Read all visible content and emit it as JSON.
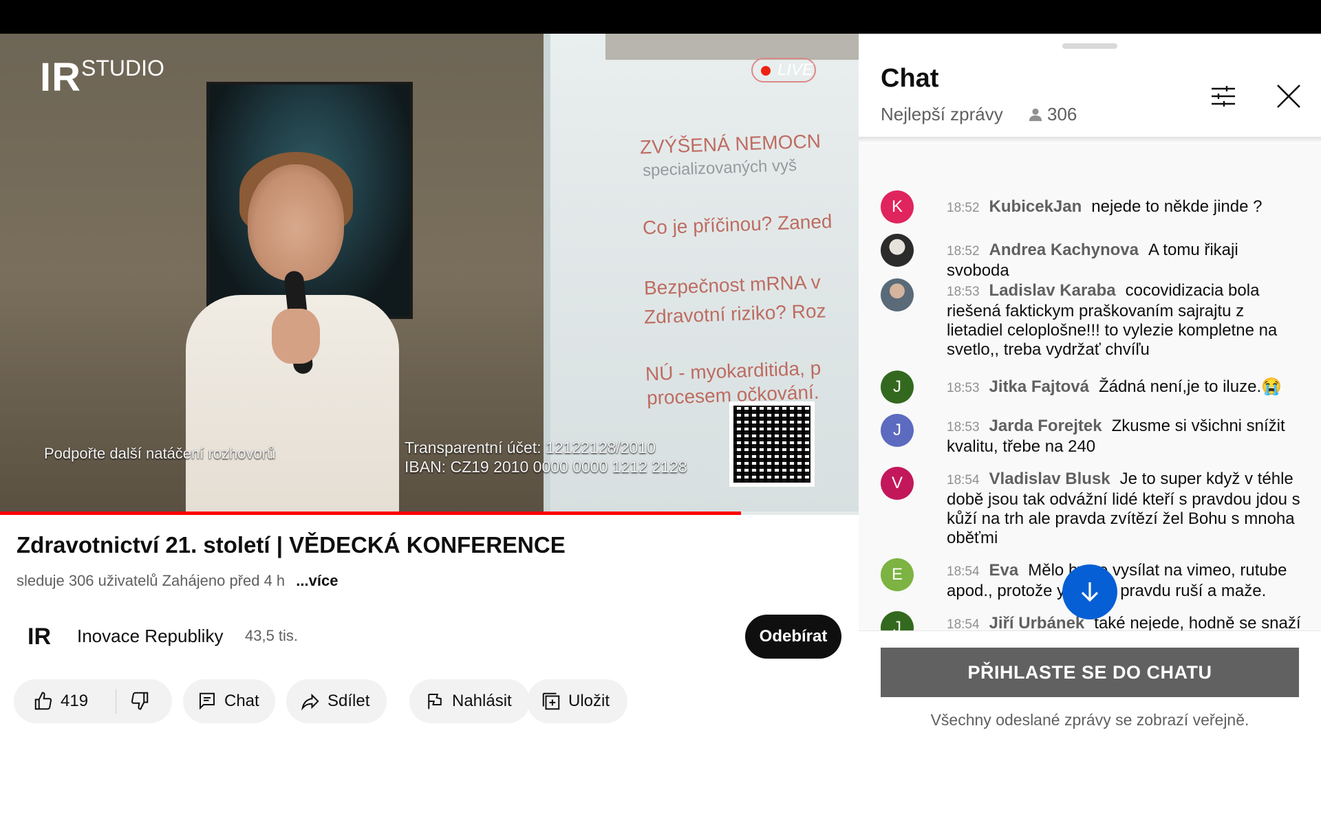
{
  "video": {
    "logo_main": "IR",
    "logo_sub": "STUDIO",
    "live_badge": "LIVE",
    "slide_lines": [
      "ZVÝŠENÁ NEMOCN",
      "specializovaných vyš",
      "Co je příčinou? Zaned",
      "Bezpečnost mRNA v",
      "Zdravotní riziko? Roz",
      "NÚ - myokarditida, p",
      "procesem očkování."
    ],
    "caption_left": "Podpořte další natáčení rozhovorů",
    "caption_right_1": "Transparentní účet: 12122128/2010",
    "caption_right_2": "IBAN: CZ19 2010 0000 0000 1212 2128",
    "progress_fraction": 0.863
  },
  "info": {
    "title": "Zdravotnictví 21. století | VĚDECKÁ KONFERENCE",
    "meta": "sleduje 306 uživatelů  Zahájeno před 4 h",
    "more": "...více",
    "channel_avatar": "IR",
    "channel_name": "Inovace Republiky",
    "channel_subs": "43,5 tis.",
    "subscribe": "Odebírat"
  },
  "actions": {
    "likes": "419",
    "chat": "Chat",
    "share": "Sdílet",
    "report": "Nahlásit",
    "save": "Uložit"
  },
  "chat": {
    "title": "Chat",
    "mode": "Nejlepší zprávy",
    "viewers": "306",
    "messages": [
      {
        "avatar": "K",
        "avatar_color": "#e0245e",
        "time": "18:52",
        "author": "KubicekJan",
        "text": "nejede to někde jinde ?"
      },
      {
        "avatar": "",
        "avatar_color": "#6a6a6a",
        "time": "18:52",
        "author": "Andrea Kachynova",
        "text": "A tomu řikaji svoboda"
      },
      {
        "avatar": "",
        "avatar_color": "#8a8a8a",
        "time": "18:53",
        "author": "Ladislav Karaba",
        "text": "cocovidizacia bola riešená faktickym praškovaním sajrajtu z lietadiel celoplošne!!! to vylezie kompletne na svetlo,, treba vydržať chvíľu"
      },
      {
        "avatar": "J",
        "avatar_color": "#33691e",
        "time": "18:53",
        "author": "Jitka Fajtová",
        "text": "Žádná není,je to iluze.😭"
      },
      {
        "avatar": "J",
        "avatar_color": "#5c6bc0",
        "time": "18:53",
        "author": "Jarda Forejtek",
        "text": "Zkusme si všichni snížit kvalitu, třebe na 240"
      },
      {
        "avatar": "V",
        "avatar_color": "#c2185b",
        "time": "18:54",
        "author": "Vladislav Blusk",
        "text": "Je to super když v téhle době jsou tak odvážní lidé kteří s pravdou jdou s kůží na trh ale pravda zvítězí žel Bohu s mnoha oběťmi"
      },
      {
        "avatar": "E",
        "avatar_color": "#7cb342",
        "time": "18:54",
        "author": "Eva",
        "text": "Mělo by se vysílat na vimeo, rutube apod., protože youtube pravdu ruší a maže."
      },
      {
        "avatar": "J",
        "avatar_color": "#33691e",
        "time": "18:54",
        "author": "Jiří Urbánek",
        "text": "také nejede, hodně se snaží temná stránka, aby pravda nevyšla najevo."
      }
    ],
    "signin": "PŘIHLASTE SE DO CHATU",
    "public_note": "Všechny odeslané zprávy se zobrazí veřejně."
  }
}
